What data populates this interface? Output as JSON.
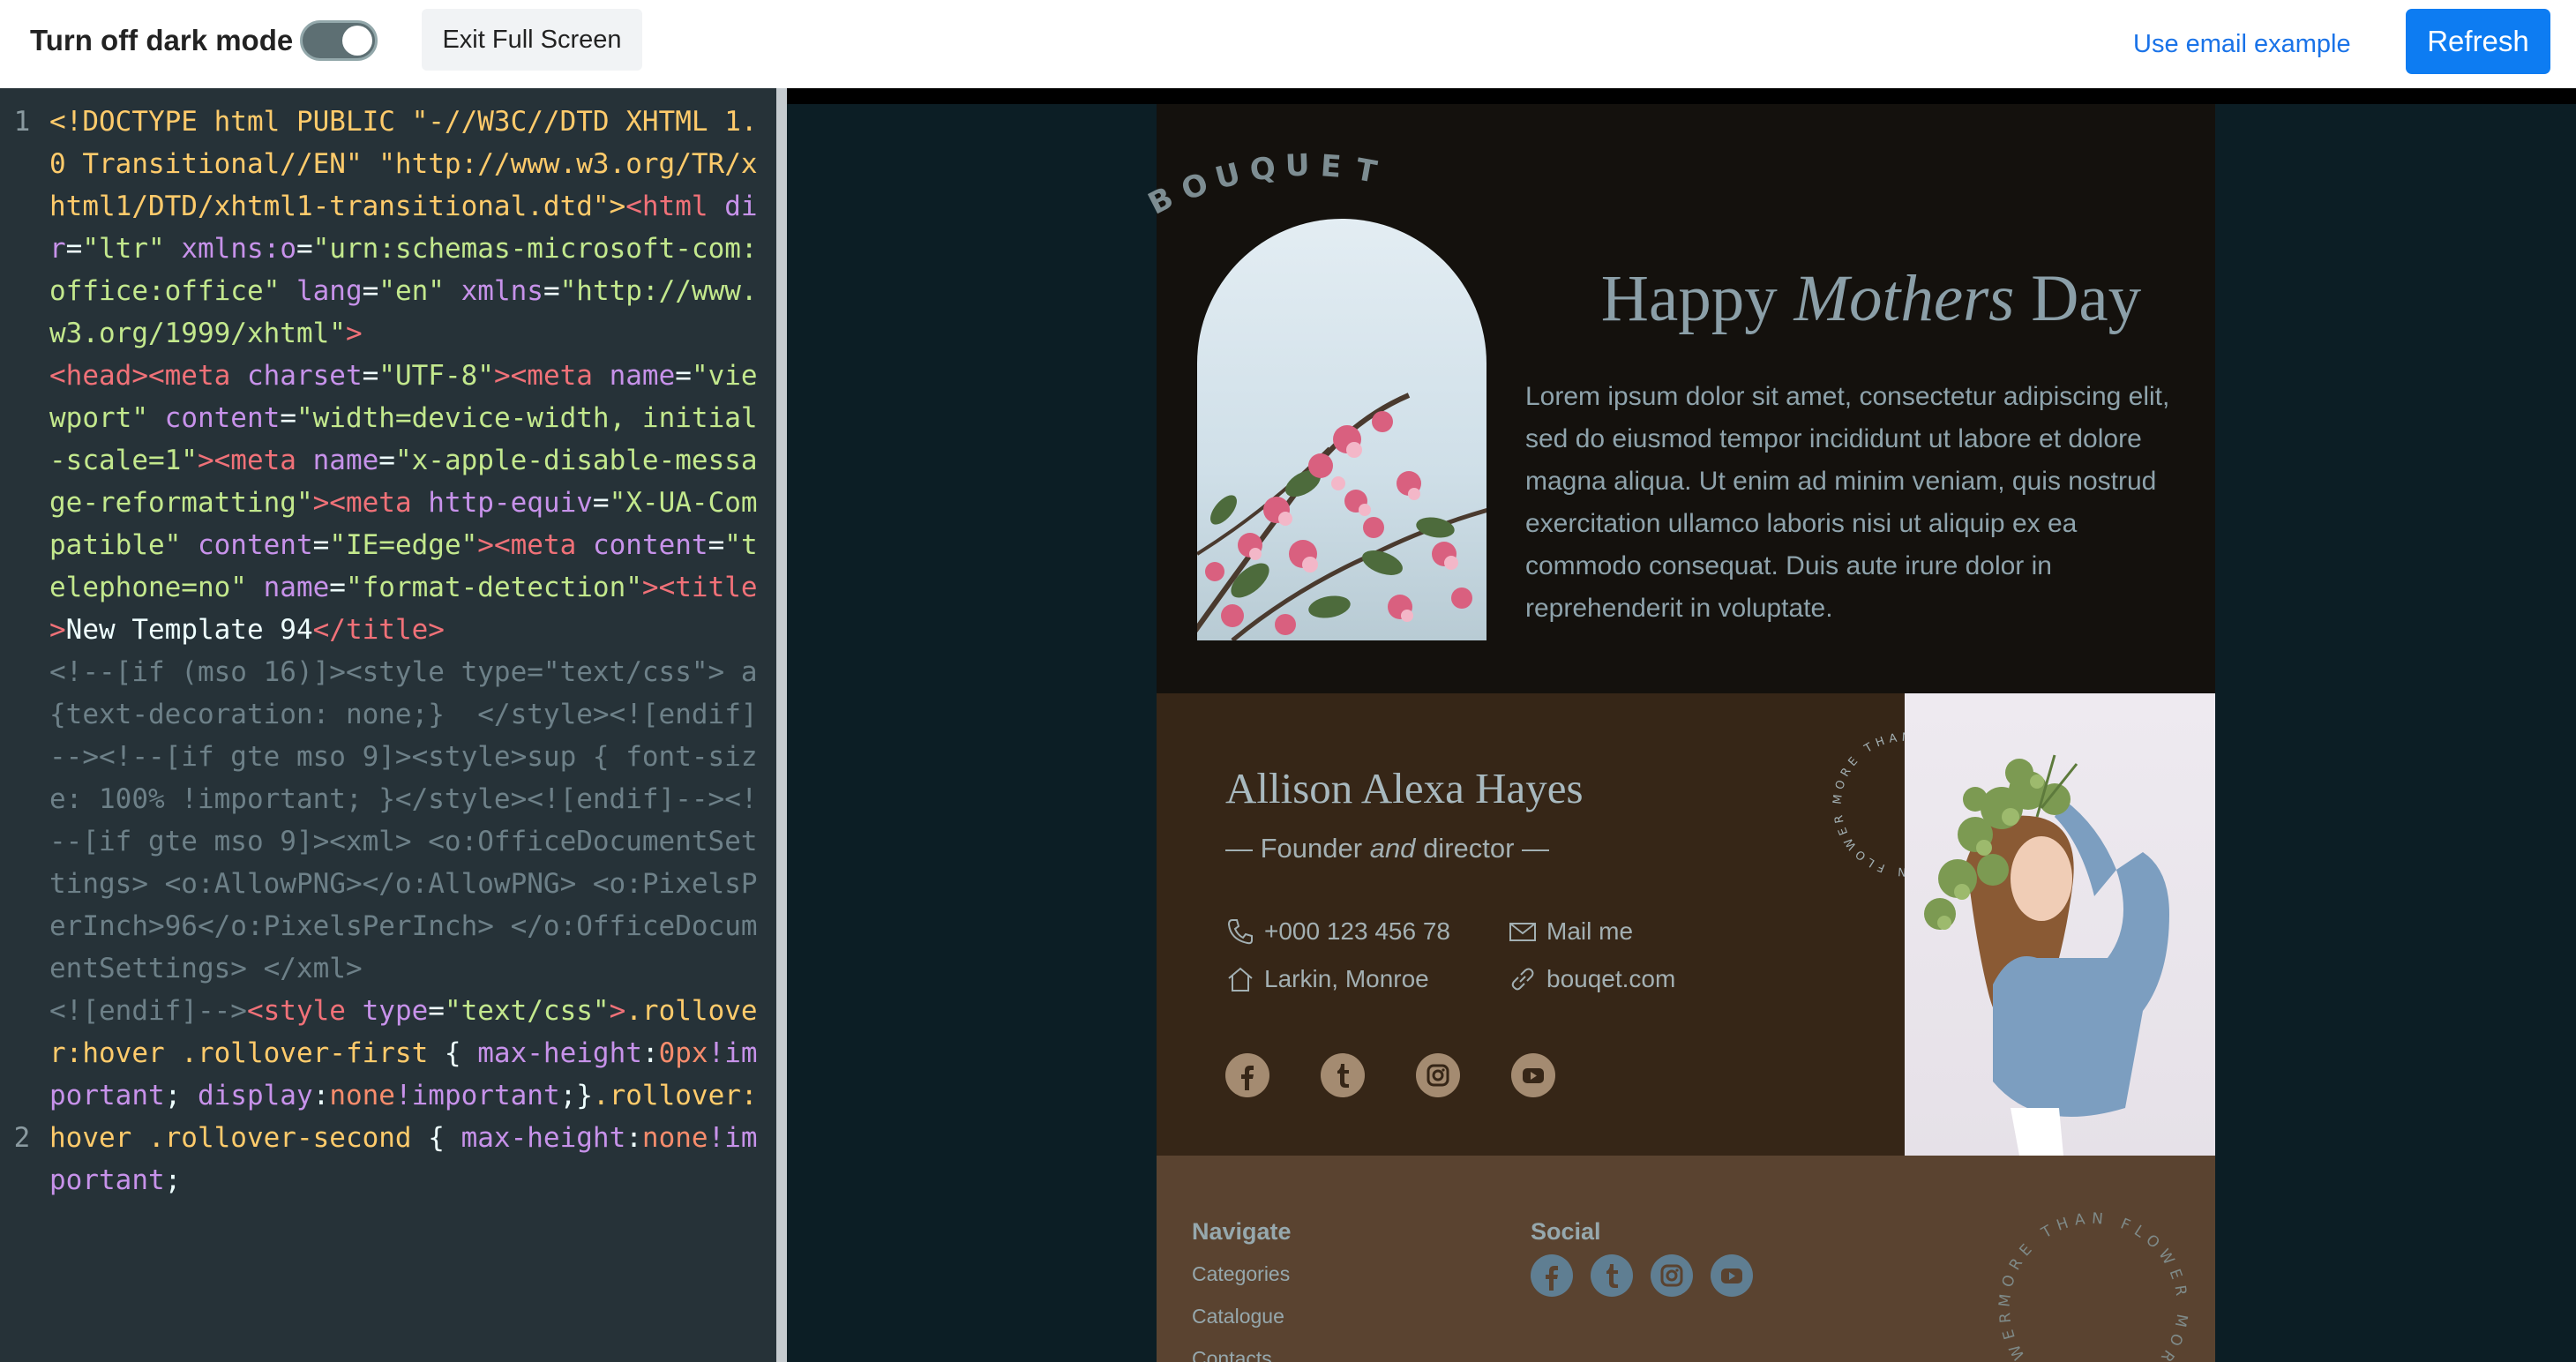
{
  "toolbar": {
    "dark_mode_label": "Turn off dark mode",
    "exit_label": "Exit Full Screen",
    "email_example_label": "Use email example",
    "refresh_label": "Refresh"
  },
  "editor": {
    "line_numbers": [
      "1",
      "2"
    ]
  },
  "email": {
    "brand": "BOUQUET",
    "hero_title_prefix": "Happy",
    "hero_title_emph": "Mothers",
    "hero_title_suffix": "Day",
    "hero_text": "Lorem ipsum dolor sit amet, consectetur adipiscing elit, sed do eiusmod tempor incididunt ut labore et dolore magna aliqua. Ut enim ad minim veniam, quis nostrud exercitation ullamco laboris nisi ut aliquip ex ea commodo consequat. Duis aute irure dolor in reprehenderit in voluptate.",
    "profile": {
      "name": "Allison Alexa Hayes",
      "role_prefix": "— Founder",
      "role_emph": "and",
      "role_suffix": "director —",
      "phone": "+000 123 456 78",
      "mail": "Mail me",
      "address": "Larkin, Monroe",
      "website": "bouqet.com",
      "ring_text": "MORE THAN FLOWER"
    },
    "footer": {
      "navigate_heading": "Navigate",
      "navigate_links": [
        "Categories",
        "Catalogue",
        "Contacts"
      ],
      "social_heading": "Social",
      "ring_text": "MORE THAN FLOWER"
    }
  },
  "colors": {
    "accent": "#0d7cf2",
    "editor_bg": "#263238",
    "preview_bg": "#0c1e25",
    "hero_bg": "#14110d",
    "profile_bg": "#362617",
    "footer_bg": "#5a4330"
  },
  "icons": {
    "phone": "phone-icon",
    "mail": "mail-icon",
    "address": "home-icon",
    "website": "link-icon",
    "socials": [
      "facebook-icon",
      "tumblr-icon",
      "instagram-icon",
      "youtube-icon"
    ]
  }
}
